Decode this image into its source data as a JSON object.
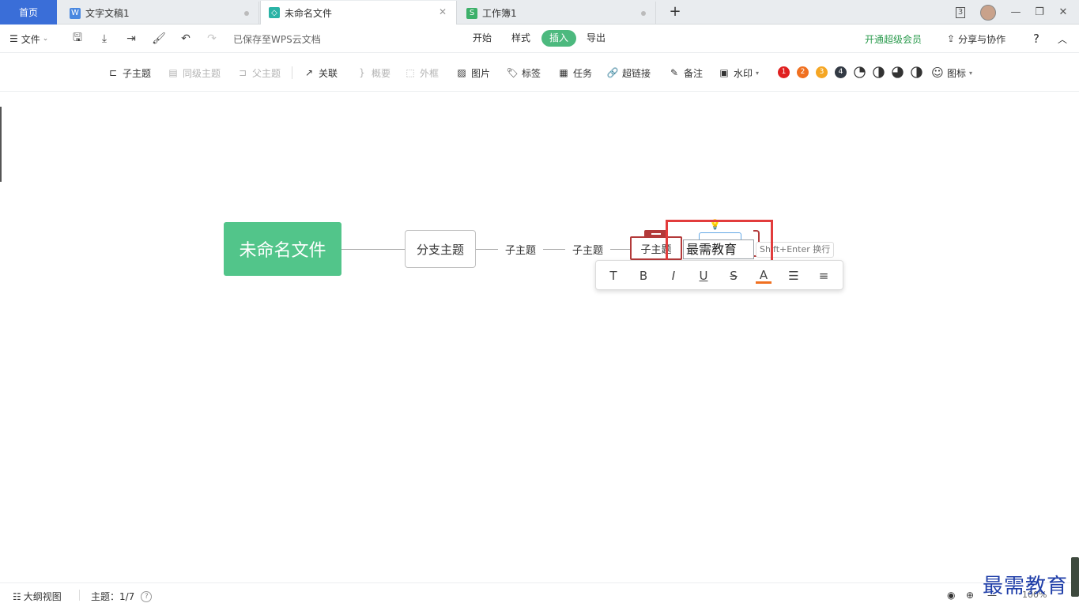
{
  "tabs": {
    "home": "首页",
    "items": [
      {
        "label": "文字文稿1",
        "icon": "W",
        "color": "#4a88e0"
      },
      {
        "label": "未命名文件",
        "icon": "◇",
        "color": "#2ab3a6"
      },
      {
        "label": "工作簿1",
        "icon": "S",
        "color": "#3db06a"
      }
    ],
    "count": "3"
  },
  "toolbar": {
    "file_menu": "文件",
    "save_status": "已保存至WPS云文档",
    "menus": [
      "开始",
      "样式",
      "插入",
      "导出"
    ],
    "active_menu": "插入",
    "vip": "开通超级会员",
    "share": "分享与协作",
    "help": "?"
  },
  "insert_toolbar": {
    "items": [
      {
        "label": "子主题",
        "icon": "subtopic-icon",
        "enabled": true
      },
      {
        "label": "同级主题",
        "icon": "sibling-topic-icon",
        "enabled": false
      },
      {
        "label": "父主题",
        "icon": "parent-topic-icon",
        "enabled": false
      },
      {
        "label": "关联",
        "icon": "relation-icon",
        "enabled": true
      },
      {
        "label": "概要",
        "icon": "summary-icon",
        "enabled": false
      },
      {
        "label": "外框",
        "icon": "boundary-icon",
        "enabled": false
      },
      {
        "label": "图片",
        "icon": "image-icon",
        "enabled": true
      },
      {
        "label": "标签",
        "icon": "tag-icon",
        "enabled": true
      },
      {
        "label": "任务",
        "icon": "task-icon",
        "enabled": true
      },
      {
        "label": "超链接",
        "icon": "link-icon",
        "enabled": true
      },
      {
        "label": "备注",
        "icon": "note-icon",
        "enabled": true
      },
      {
        "label": "水印",
        "icon": "watermark-icon",
        "enabled": true
      }
    ],
    "priorities": [
      {
        "label": "1",
        "color": "#e02020"
      },
      {
        "label": "2",
        "color": "#f07020"
      },
      {
        "label": "3",
        "color": "#f5a623"
      },
      {
        "label": "4",
        "color": "#333a44"
      }
    ],
    "icons_label": "图标"
  },
  "mindmap": {
    "root": "未命名文件",
    "branch": "分支主题",
    "subtopics": [
      "子主题",
      "子主题"
    ],
    "selected": "子主题",
    "editing_value": "最需教育",
    "hint": "Shift+Enter 换行"
  },
  "format_bar": [
    "T",
    "B",
    "I",
    "U",
    "S",
    "A"
  ],
  "status": {
    "outline": "大纲视图",
    "topic_label": "主题：1/7",
    "zoom": "100%"
  },
  "watermark_text": "最需教育"
}
